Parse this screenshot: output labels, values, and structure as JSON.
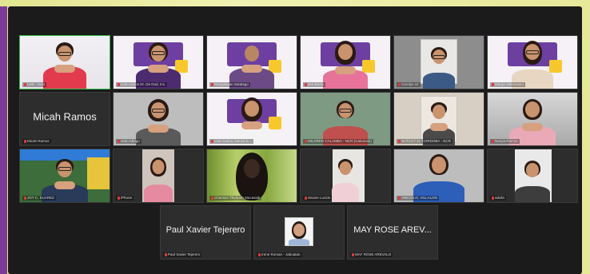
{
  "participants": [
    {
      "id": "p1",
      "label": "LNE - Host",
      "active": true
    },
    {
      "id": "p2",
      "label": "LNE Carlos Dr. De Dud, Inc."
    },
    {
      "id": "p3",
      "label": "Pengalayan Santiago"
    },
    {
      "id": "p4",
      "label": "Jen Bacla"
    },
    {
      "id": "p5",
      "label": "Carolyn Ur"
    },
    {
      "id": "p6",
      "label": "Marga Valenciano"
    },
    {
      "id": "p7",
      "label": "Micah Ramos",
      "display_name": "Micah Ramos"
    },
    {
      "id": "p8",
      "label": "Jean Abrigo"
    },
    {
      "id": "p9",
      "label": "LNE Carlos, Neuva E..."
    },
    {
      "id": "p10",
      "label": "MILDRED CALAMBA - NCR (Caloocan)"
    },
    {
      "id": "p11",
      "label": "NURLEY M. CORDOBA - NCR"
    },
    {
      "id": "p12",
      "label": "Nenya Ramos"
    },
    {
      "id": "p13",
      "label": "JOY C. SUAREZ"
    },
    {
      "id": "p14",
      "label": "iPhone"
    },
    {
      "id": "p15",
      "label": "Charisse Theareth Macasiab"
    },
    {
      "id": "p16",
      "label": "Sisane Lucido"
    },
    {
      "id": "p17",
      "label": "AREVALO, VILLALON"
    },
    {
      "id": "p18",
      "label": "adolin"
    },
    {
      "id": "p19",
      "label": "Paul Xavier Tejerero",
      "display_name": "Paul Xavier Tejerero"
    },
    {
      "id": "p20",
      "label": "Irene Roman - Jaboatan"
    },
    {
      "id": "p21",
      "label": "MAY ROSE AREVALO",
      "display_name": "MAY ROSE AREV..."
    }
  ],
  "colors": {
    "accent": "#2ebd48",
    "mic_muted": "#e03b3b",
    "tile_bg": "#2d2d2d",
    "frame_left": "#7d3b97"
  }
}
